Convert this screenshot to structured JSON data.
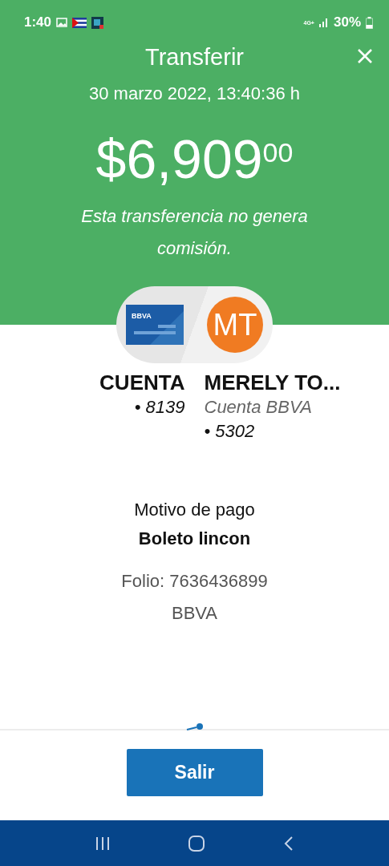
{
  "status_bar": {
    "time": "1:40",
    "network": "4G+",
    "battery": "30%"
  },
  "header": {
    "title": "Transferir",
    "date": "30 marzo 2022, 13:40:36 h",
    "amount": "$6,909$^{00}$",
    "note": "Esta transferencia no genera comisión."
  },
  "parties": {
    "card_brand": "BBVA",
    "avatar_initials": "MT",
    "origin": {
      "name": "CUENTA",
      "account": "• 8139"
    },
    "destination": {
      "name": "MERELY TO...",
      "bank": "Cuenta BBVA",
      "account": "• 5302"
    }
  },
  "details": {
    "label": "Motivo de pago",
    "concept": "Boleto lincon",
    "folio": "Folio: 7636436899",
    "bank": "BBVA"
  },
  "footer": {
    "button": "Salir"
  }
}
